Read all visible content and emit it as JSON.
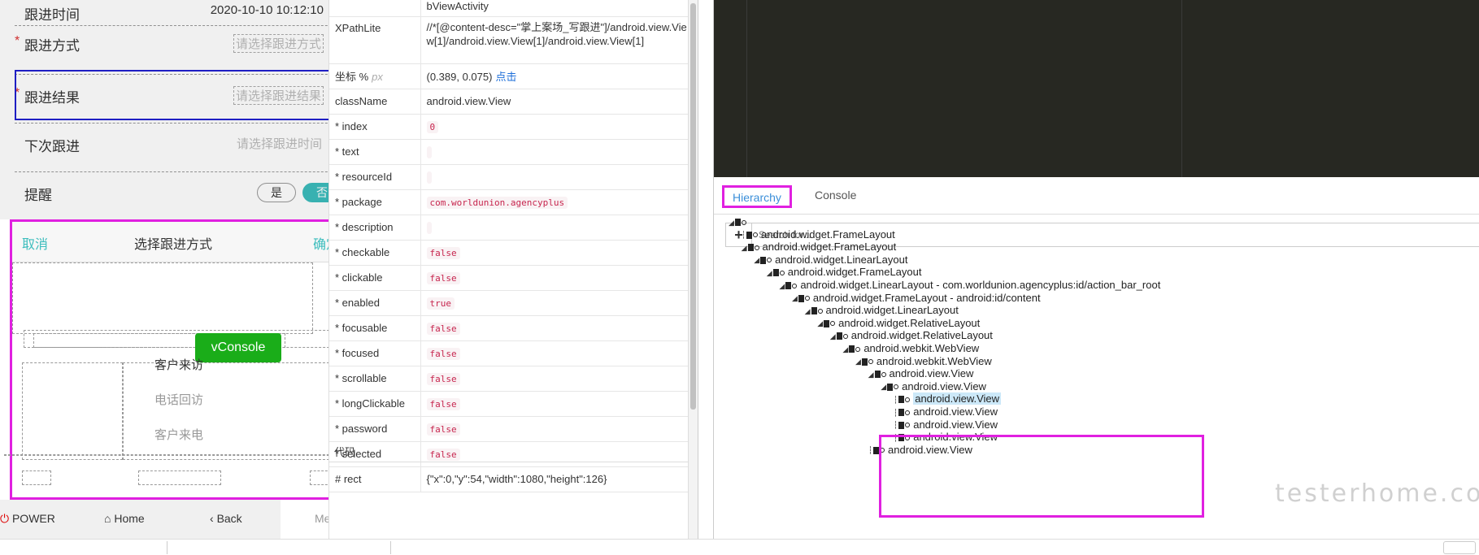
{
  "phone": {
    "top_row_label": "跟进时间",
    "top_row_value": "2020-10-10 10:12:10",
    "rows": [
      {
        "label": "跟进方式",
        "placeholder": "请选择跟进方式",
        "required": "*"
      },
      {
        "label": "跟进结果",
        "placeholder": "请选择跟进结果",
        "required": "*"
      },
      {
        "label": "下次跟进",
        "placeholder": "请选择跟进时间",
        "required": ""
      }
    ],
    "reminder_label": "提醒",
    "reminder_yes": "是",
    "reminder_no": "否",
    "sheet_cancel": "取消",
    "sheet_title": "选择跟进方式",
    "sheet_confirm": "确定",
    "options": [
      "客户来访",
      "电话回访",
      "客户来电"
    ],
    "vconsole": "vConsole",
    "toolbar": {
      "power": "POWER",
      "home": "Home",
      "back": "Back",
      "menu": "Menu"
    }
  },
  "props": {
    "activity_tail": "bViewActivity",
    "rows": [
      {
        "key": "XPathLite",
        "value": "//*[@content-desc=\"掌上案场_写跟进\"]/android.view.View[1]/android.view.View[1]/android.view.View[1]",
        "kind": "text"
      },
      {
        "key": "坐标 %",
        "key_unit": "px",
        "value": "(0.389, 0.075)",
        "link": "点击",
        "kind": "coord"
      },
      {
        "key": "className",
        "value": "android.view.View",
        "kind": "text"
      },
      {
        "key": "* index",
        "value": "0",
        "kind": "code"
      },
      {
        "key": "* text",
        "value": "",
        "kind": "code"
      },
      {
        "key": "* resourceId",
        "value": "",
        "kind": "code"
      },
      {
        "key": "* package",
        "value": "com.worldunion.agencyplus",
        "kind": "code"
      },
      {
        "key": "* description",
        "value": "",
        "kind": "code"
      },
      {
        "key": "* checkable",
        "value": "false",
        "kind": "code"
      },
      {
        "key": "* clickable",
        "value": "false",
        "kind": "code"
      },
      {
        "key": "* enabled",
        "value": "true",
        "kind": "code"
      },
      {
        "key": "* focusable",
        "value": "false",
        "kind": "code"
      },
      {
        "key": "* focused",
        "value": "false",
        "kind": "code"
      },
      {
        "key": "* scrollable",
        "value": "false",
        "kind": "code"
      },
      {
        "key": "* longClickable",
        "value": "false",
        "kind": "code"
      },
      {
        "key": "* password",
        "value": "false",
        "kind": "code"
      },
      {
        "key": "* selected",
        "value": "false",
        "kind": "code"
      },
      {
        "key": "# rect",
        "value": "{\"x\":0,\"y\":54,\"width\":1080,\"height\":126}",
        "kind": "text"
      }
    ],
    "code_label": "代码"
  },
  "inspector": {
    "tabs": [
      "Hierarchy",
      "Console"
    ],
    "search_placeholder": "Search for...",
    "add_label": "+",
    "tree": [
      {
        "depth": 0,
        "text": "",
        "arrow": "open"
      },
      {
        "depth": 1,
        "text": "android.widget.FrameLayout",
        "arrow": "leaf"
      },
      {
        "depth": 1,
        "text": "android.widget.FrameLayout",
        "arrow": "open"
      },
      {
        "depth": 2,
        "text": "android.widget.LinearLayout",
        "arrow": "open"
      },
      {
        "depth": 3,
        "text": "android.widget.FrameLayout",
        "arrow": "open"
      },
      {
        "depth": 4,
        "text": "android.widget.LinearLayout - com.worldunion.agencyplus:id/action_bar_root",
        "arrow": "open"
      },
      {
        "depth": 5,
        "text": "android.widget.FrameLayout - android:id/content",
        "arrow": "open"
      },
      {
        "depth": 6,
        "text": "android.widget.LinearLayout",
        "arrow": "open"
      },
      {
        "depth": 7,
        "text": "android.widget.RelativeLayout",
        "arrow": "open"
      },
      {
        "depth": 8,
        "text": "android.widget.RelativeLayout",
        "arrow": "open"
      },
      {
        "depth": 9,
        "text": "android.webkit.WebView",
        "arrow": "open"
      },
      {
        "depth": 10,
        "text": "android.webkit.WebView",
        "arrow": "open"
      },
      {
        "depth": 11,
        "text": "android.view.View",
        "arrow": "open"
      },
      {
        "depth": 12,
        "text": "android.view.View",
        "arrow": "open"
      },
      {
        "depth": 13,
        "text": "android.view.View",
        "arrow": "leaf",
        "selected": true
      },
      {
        "depth": 13,
        "text": "android.view.View",
        "arrow": "leaf"
      },
      {
        "depth": 13,
        "text": "android.view.View",
        "arrow": "leaf"
      },
      {
        "depth": 13,
        "text": "android.view.View",
        "arrow": "leaf"
      },
      {
        "depth": 11,
        "text": "android.view.View",
        "arrow": "leaf"
      }
    ]
  },
  "watermark": "testerhome.com",
  "colors": {
    "highlight": "#e020e0",
    "blue_outline": "#2020d0",
    "green": "#1aad19",
    "teal": "#3cbdbd",
    "link": "#1e6fd9",
    "selected_bg": "#cce8f8"
  }
}
